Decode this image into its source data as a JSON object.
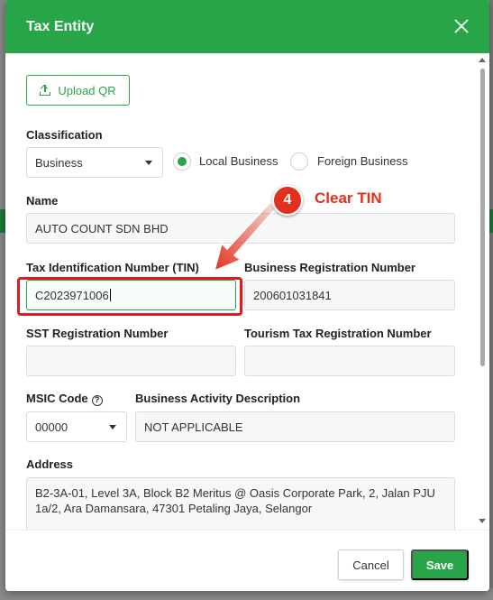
{
  "dialog": {
    "title": "Tax Entity"
  },
  "upload_button": {
    "label": "Upload QR",
    "icon": "upload-icon"
  },
  "classification": {
    "label": "Classification",
    "selected": "Business",
    "options": [
      {
        "label": "Local Business",
        "checked": true
      },
      {
        "label": "Foreign Business",
        "checked": false
      }
    ]
  },
  "name": {
    "label": "Name",
    "value": "AUTO COUNT SDN BHD"
  },
  "tin": {
    "label": "Tax Identification Number (TIN)",
    "value": "C2023971006"
  },
  "brn": {
    "label": "Business Registration Number",
    "value": "200601031841"
  },
  "sst": {
    "label": "SST Registration Number",
    "value": ""
  },
  "tourism": {
    "label": "Tourism Tax Registration Number",
    "value": ""
  },
  "msic": {
    "label": "MSIC Code",
    "selected": "00000"
  },
  "business_activity": {
    "label": "Business Activity Description",
    "value": "NOT APPLICABLE"
  },
  "address": {
    "label": "Address",
    "value": "B2-3A-01, Level 3A, Block B2 Meritus @ Oasis Corporate Park, 2, Jalan PJU 1a/2, Ara Damansara, 47301 Petaling Jaya, Selangor"
  },
  "footer": {
    "cancel_label": "Cancel",
    "save_label": "Save"
  },
  "annotation": {
    "step": "4",
    "text": "Clear TIN",
    "color": "#e0311f"
  },
  "colors": {
    "primary": "#27a548",
    "highlight": "#e01b1b"
  }
}
